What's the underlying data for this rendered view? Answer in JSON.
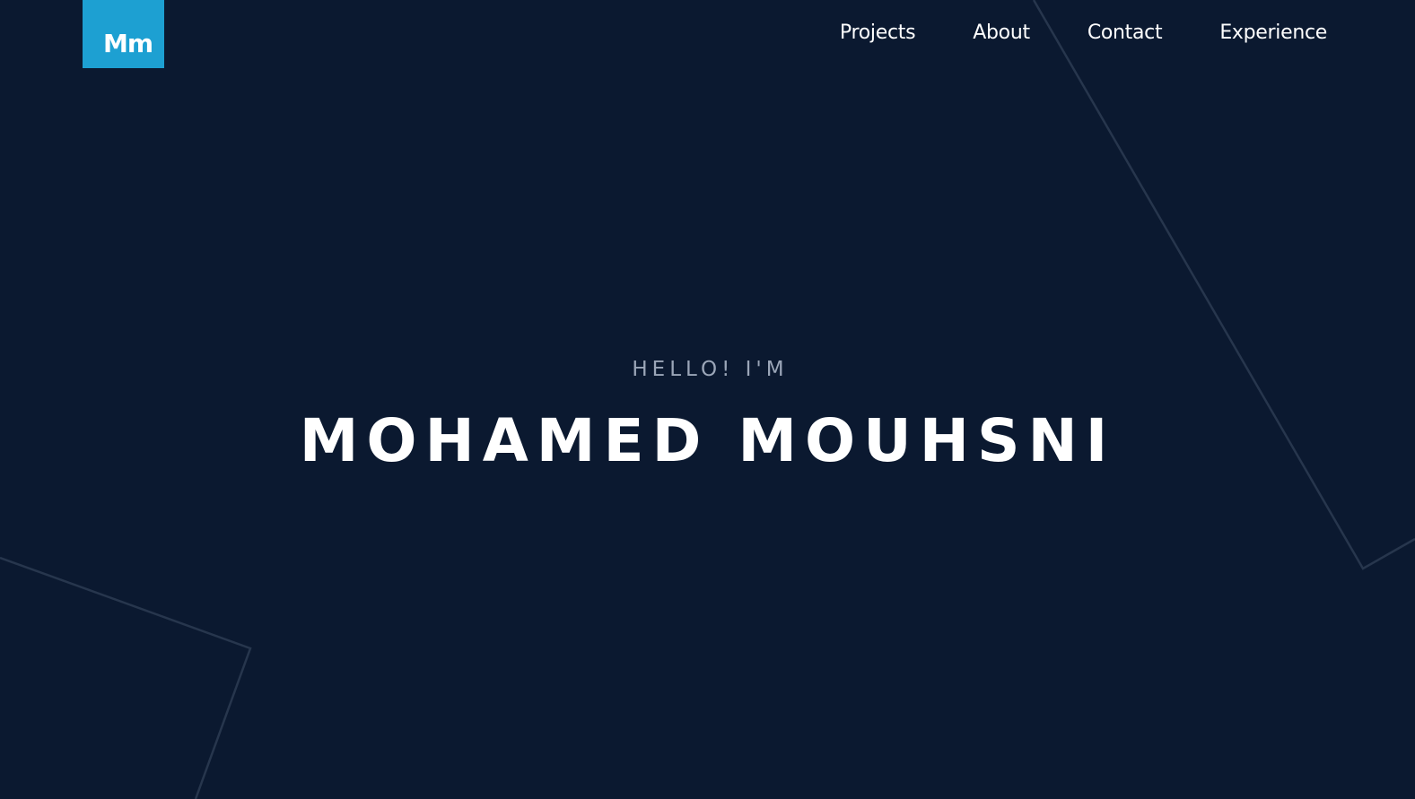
{
  "logo": {
    "text": "Mm"
  },
  "nav": {
    "items": [
      {
        "label": "Projects"
      },
      {
        "label": "About"
      },
      {
        "label": "Contact"
      },
      {
        "label": "Experience"
      }
    ]
  },
  "hero": {
    "greeting": "HELLO! I'M",
    "name": "MOHAMED MOUHSNI"
  },
  "colors": {
    "background": "#0b1930",
    "accent": "#1da0d2",
    "text": "#ffffff",
    "muted_text": "#9ba6b8",
    "decor_lines": "#27364d"
  }
}
